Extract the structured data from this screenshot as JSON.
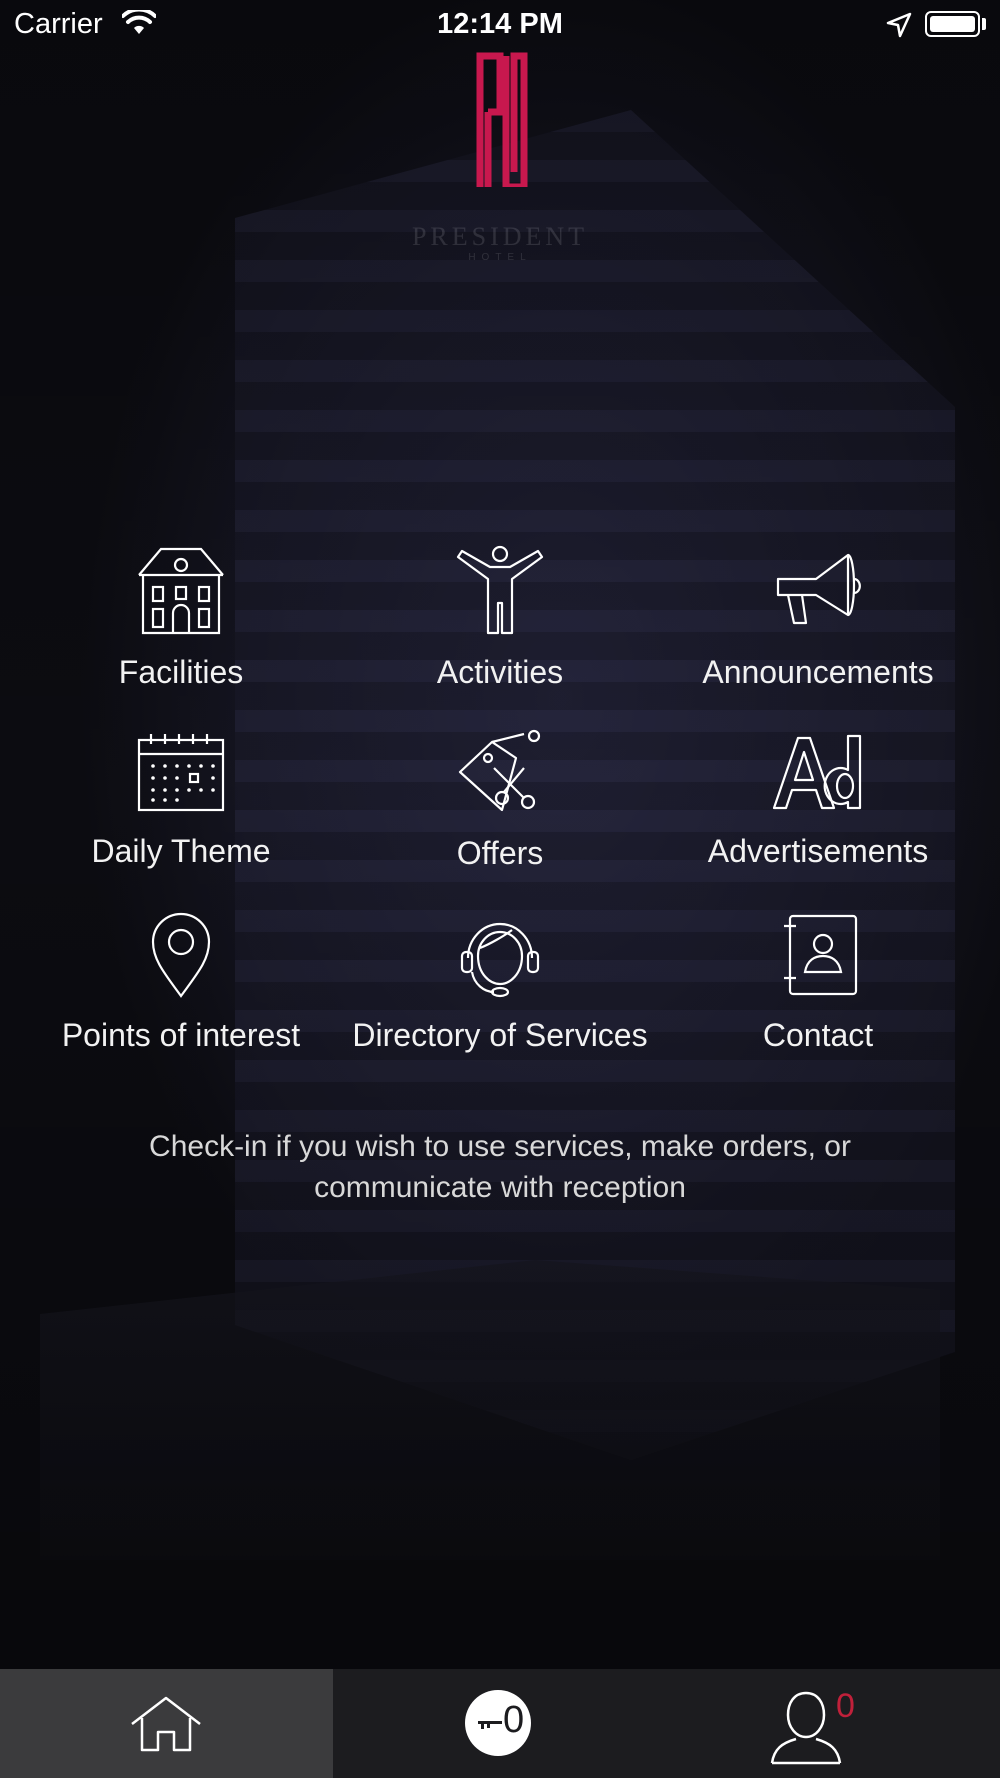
{
  "status_bar": {
    "carrier": "Carrier",
    "time": "12:14 PM"
  },
  "brand": {
    "accent_color": "#c8184e",
    "name": "PRESIDENT",
    "sub": "HOTEL"
  },
  "menu": [
    {
      "label": "Facilities",
      "icon": "building-icon"
    },
    {
      "label": "Activities",
      "icon": "person-arms-up-icon"
    },
    {
      "label": "Announcements",
      "icon": "megaphone-icon"
    },
    {
      "label": "Daily Theme",
      "icon": "calendar-icon"
    },
    {
      "label": "Offers",
      "icon": "tag-scissors-icon"
    },
    {
      "label": "Advertisements",
      "icon": "ad-icon"
    },
    {
      "label": "Points of interest",
      "icon": "map-pin-icon"
    },
    {
      "label": "Directory of Services",
      "icon": "headset-agent-icon"
    },
    {
      "label": "Contact",
      "icon": "contact-book-icon"
    }
  ],
  "notice": "Check-in if you wish to use services, make orders, or communicate with reception",
  "tab_bar": {
    "home_icon": "home-icon",
    "key_count": "0",
    "user_count": "0",
    "count_color": "#c0203a"
  }
}
